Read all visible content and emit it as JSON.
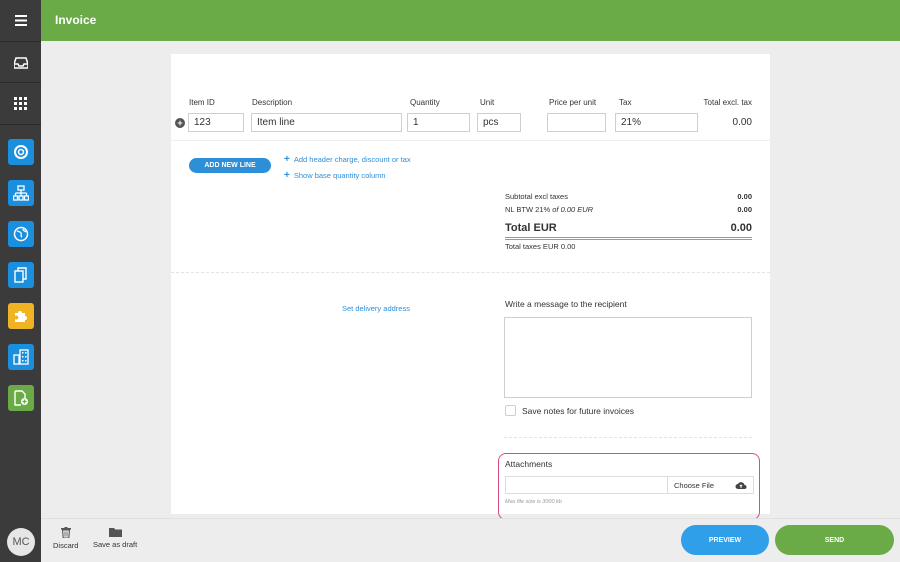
{
  "header": {
    "title": "Invoice"
  },
  "sidebar": {
    "apps": [
      {
        "name": "support",
        "color": "#1a8fde"
      },
      {
        "name": "org-chart",
        "color": "#1a8fde"
      },
      {
        "name": "globe",
        "color": "#1a8fde"
      },
      {
        "name": "documents",
        "color": "#1a8fde"
      },
      {
        "name": "puzzle",
        "color": "#f0b323"
      },
      {
        "name": "buildings",
        "color": "#1a8fde"
      },
      {
        "name": "new-invoice",
        "color": "#6aab47"
      }
    ],
    "avatar": "MC"
  },
  "table": {
    "columns": {
      "item_id": "Item ID",
      "description": "Description",
      "quantity": "Quantity",
      "unit": "Unit",
      "price": "Price per unit",
      "tax": "Tax",
      "total": "Total excl. tax"
    },
    "row": {
      "item_id": "123",
      "description": "Item line",
      "quantity": "1",
      "unit": "pcs",
      "price": "",
      "tax": "21%",
      "total": "0.00"
    },
    "add_line": "ADD NEW LINE",
    "add_header_charge": "Add header charge, discount or tax",
    "show_base_quantity": "Show base quantity column"
  },
  "summary": {
    "subtotal_label": "Subtotal excl taxes",
    "subtotal_value": "0.00",
    "tax_label_prefix": "NL BTW 21% ",
    "tax_label_italic": "of 0.00 EUR",
    "tax_value": "0.00",
    "total_label": "Total EUR",
    "total_value": "0.00",
    "total_taxes": "Total taxes EUR 0.00"
  },
  "delivery": {
    "link": "Set delivery address"
  },
  "message": {
    "label": "Write a message to the recipient",
    "save_notes": "Save notes for future invoices"
  },
  "attachments": {
    "label": "Attachments",
    "choose": "Choose File",
    "hint": "Max file size is 3000 kb"
  },
  "footer": {
    "discard": "Discard",
    "save_draft": "Save as draft",
    "preview": "PREVIEW",
    "send": "SEND"
  },
  "colors": {
    "header": "#6aab47",
    "primary_blue": "#2e8fd9",
    "attachment_highlight": "#d64b8a"
  }
}
